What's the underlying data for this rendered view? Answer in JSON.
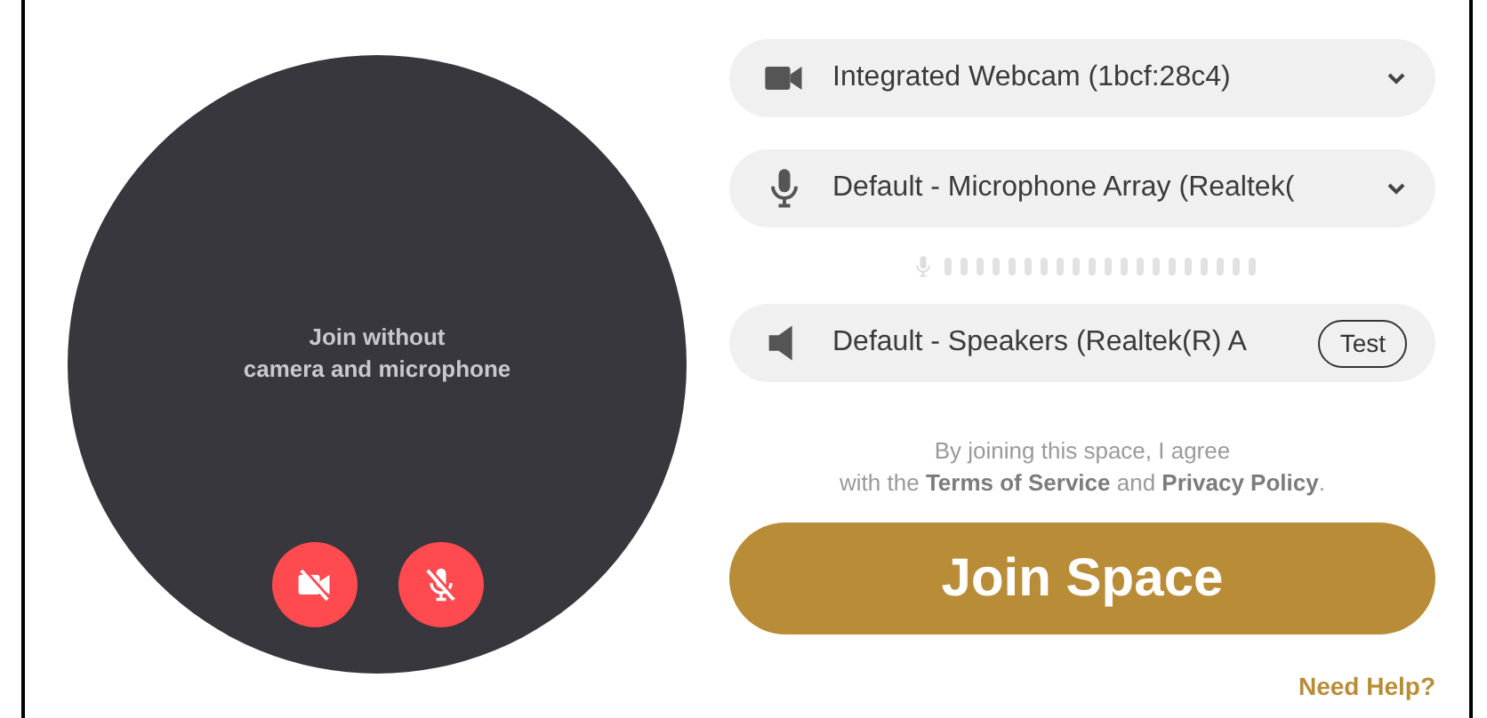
{
  "preview": {
    "message": "Join without\ncamera and microphone",
    "toggles": [
      {
        "kind": "camera",
        "muted": true
      },
      {
        "kind": "microphone",
        "muted": true
      }
    ]
  },
  "devices": [
    {
      "kind": "camera",
      "label": "Integrated Webcam (1bcf:28c4)"
    },
    {
      "kind": "microphone",
      "label": "Default - Microphone Array (Realtek(",
      "meter": true
    },
    {
      "kind": "speaker",
      "label": "Default - Speakers (Realtek(R) A",
      "action": "Test"
    }
  ],
  "terms": {
    "line_1": "By joining this space, I agree",
    "prefix": "with the",
    "link_1": "Terms of Service",
    "middle": "and",
    "link_2": "Privacy Policy",
    "suffix": "."
  },
  "join_button": "Join Space",
  "help_link": "Need Help?"
}
